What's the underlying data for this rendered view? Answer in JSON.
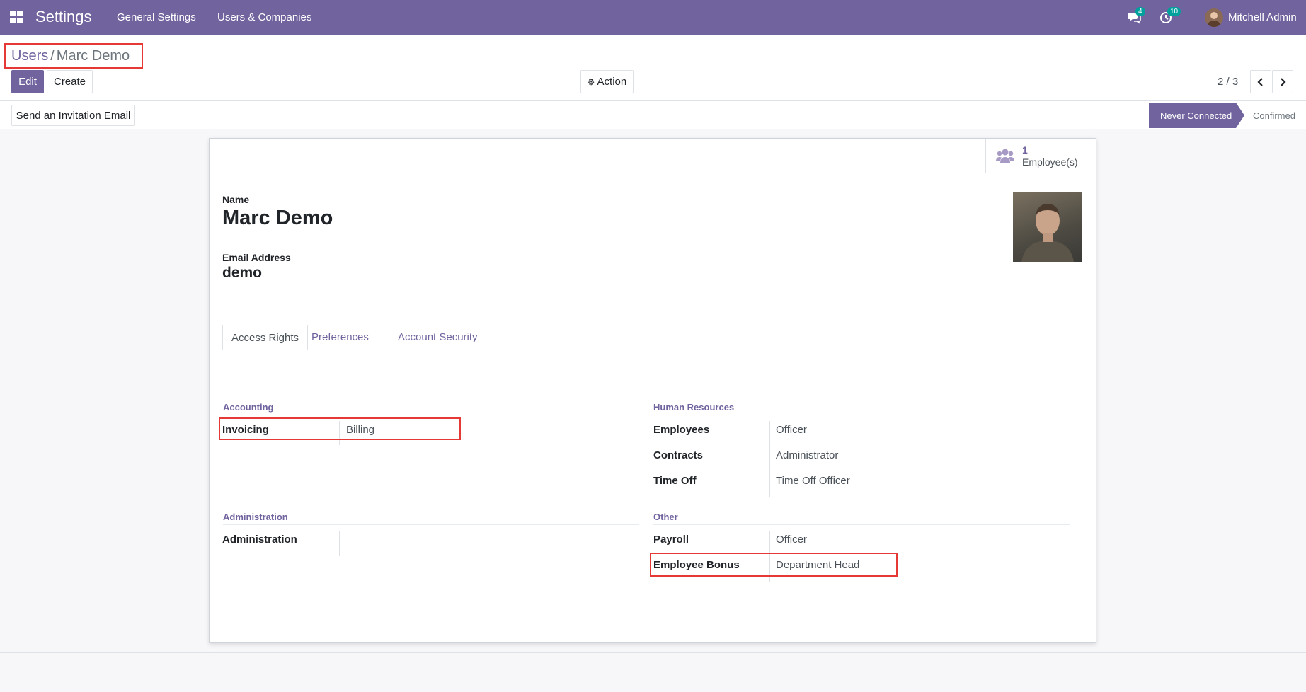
{
  "navbar": {
    "app_name": "Settings",
    "menu": [
      "General Settings",
      "Users & Companies"
    ],
    "messages_count": "4",
    "activities_count": "10",
    "user_name": "Mitchell Admin"
  },
  "breadcrumb": {
    "parent": "Users",
    "separator": "/",
    "current": "Marc Demo"
  },
  "buttons": {
    "edit": "Edit",
    "create": "Create",
    "action": "Action",
    "send_invitation": "Send an Invitation Email"
  },
  "pager": {
    "value": "2 / 3"
  },
  "status": {
    "active": "Never Connected",
    "next": "Confirmed"
  },
  "stat_button": {
    "value": "1",
    "label": "Employee(s)"
  },
  "form": {
    "name_label": "Name",
    "name": "Marc Demo",
    "email_label": "Email Address",
    "email": "demo"
  },
  "tabs": [
    "Access Rights",
    "Preferences",
    "Account Security"
  ],
  "groups": {
    "accounting": {
      "title": "Accounting",
      "rows": [
        {
          "label": "Invoicing",
          "value": "Billing"
        }
      ]
    },
    "administration": {
      "title": "Administration",
      "rows": [
        {
          "label": "Administration",
          "value": ""
        }
      ]
    },
    "human_resources": {
      "title": "Human Resources",
      "rows": [
        {
          "label": "Employees",
          "value": "Officer"
        },
        {
          "label": "Contracts",
          "value": "Administrator"
        },
        {
          "label": "Time Off",
          "value": "Time Off Officer"
        }
      ]
    },
    "other": {
      "title": "Other",
      "rows": [
        {
          "label": "Payroll",
          "value": "Officer"
        },
        {
          "label": "Employee Bonus",
          "value": "Department Head"
        }
      ]
    }
  },
  "colors": {
    "brand": "#71639e",
    "highlight": "#e53935"
  }
}
